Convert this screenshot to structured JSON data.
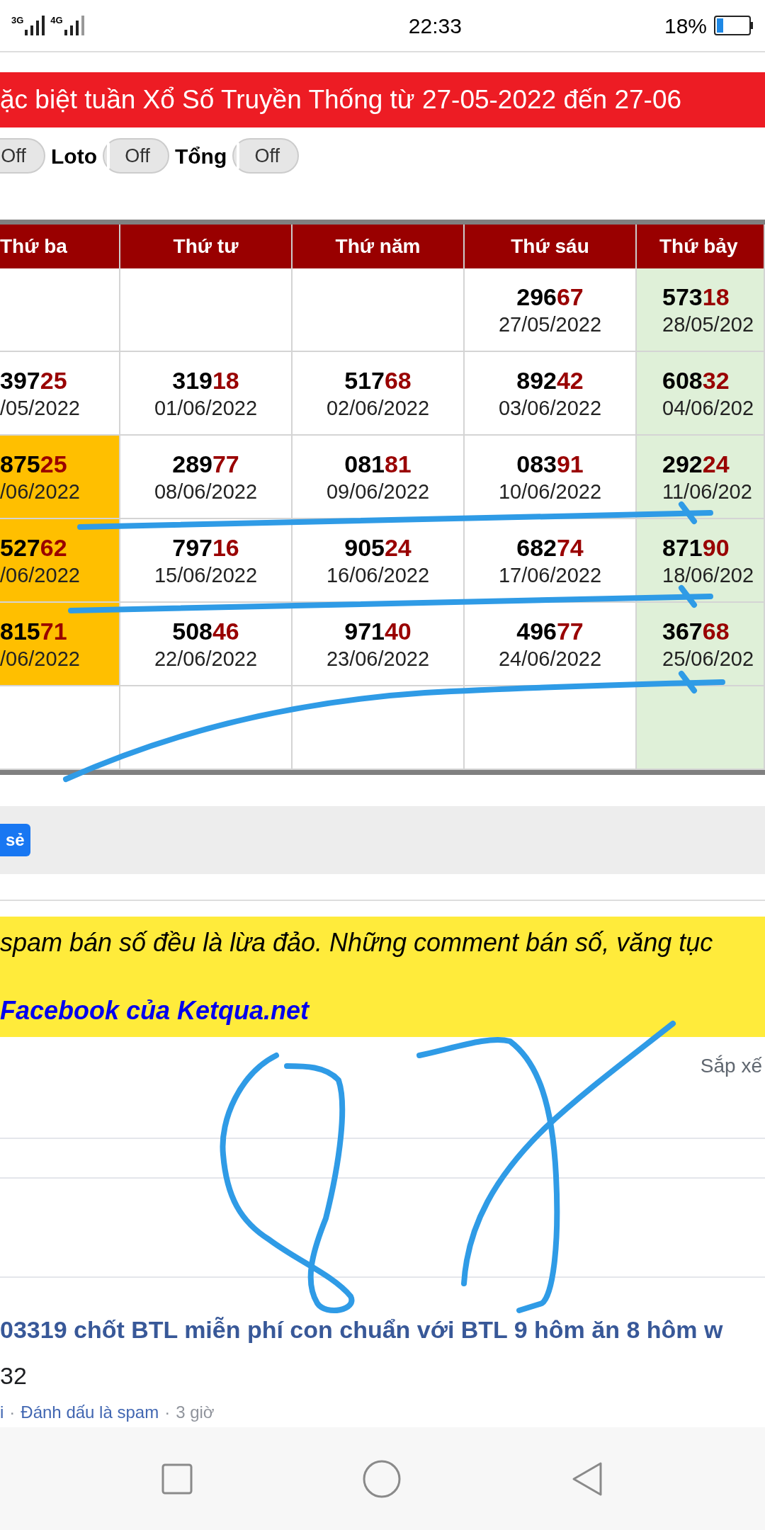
{
  "status_bar": {
    "network_1": "3G",
    "network_2": "4G",
    "time": "22:33",
    "battery": "18%"
  },
  "banner": {
    "title": "ặc biệt tuần Xổ Số Truyền Thống từ 27-05-2022 đến 27-06"
  },
  "toggles": [
    {
      "state_text": "Off",
      "on": false
    },
    {
      "label": "Loto",
      "state_text": "Off",
      "on": false
    },
    {
      "label": "Tổng",
      "state_text": "Off",
      "on": false
    }
  ],
  "table": {
    "columns": [
      "Thứ ba",
      "Thứ tư",
      "Thứ năm",
      "Thứ sáu",
      "Thứ bảy"
    ],
    "rows": [
      [
        {
          "color": "#ffffff"
        },
        {
          "color": "#ffffff"
        },
        {
          "color": "#ffffff"
        },
        {
          "prefix": "296",
          "tail": "67",
          "date": "27/05/2022",
          "color": "#ffffff"
        },
        {
          "prefix": "573",
          "tail": "18",
          "date": "28/05/202",
          "color": "#dff0d8"
        }
      ],
      [
        {
          "prefix": "397",
          "tail": "25",
          "date": "/05/2022",
          "color": "#ffffff"
        },
        {
          "prefix": "319",
          "tail": "18",
          "date": "01/06/2022",
          "color": "#ffffff"
        },
        {
          "prefix": "517",
          "tail": "68",
          "date": "02/06/2022",
          "color": "#ffffff"
        },
        {
          "prefix": "892",
          "tail": "42",
          "date": "03/06/2022",
          "color": "#ffffff"
        },
        {
          "prefix": "608",
          "tail": "32",
          "date": "04/06/202",
          "color": "#dff0d8"
        }
      ],
      [
        {
          "prefix": "875",
          "tail": "25",
          "date": "/06/2022",
          "color": "#ffbf00"
        },
        {
          "prefix": "289",
          "tail": "77",
          "date": "08/06/2022",
          "color": "#ffffff"
        },
        {
          "prefix": "081",
          "tail": "81",
          "date": "09/06/2022",
          "color": "#ffffff"
        },
        {
          "prefix": "083",
          "tail": "91",
          "date": "10/06/2022",
          "color": "#ffffff"
        },
        {
          "prefix": "292",
          "tail": "24",
          "date": "11/06/202",
          "color": "#dff0d8"
        }
      ],
      [
        {
          "prefix": "527",
          "tail": "62",
          "date": "/06/2022",
          "color": "#ffbf00"
        },
        {
          "prefix": "797",
          "tail": "16",
          "date": "15/06/2022",
          "color": "#ffffff"
        },
        {
          "prefix": "905",
          "tail": "24",
          "date": "16/06/2022",
          "color": "#ffffff"
        },
        {
          "prefix": "682",
          "tail": "74",
          "date": "17/06/2022",
          "color": "#ffffff"
        },
        {
          "prefix": "871",
          "tail": "90",
          "date": "18/06/202",
          "color": "#dff0d8"
        }
      ],
      [
        {
          "prefix": "815",
          "tail": "71",
          "date": "/06/2022",
          "color": "#ffbf00"
        },
        {
          "prefix": "508",
          "tail": "46",
          "date": "22/06/2022",
          "color": "#ffffff"
        },
        {
          "prefix": "971",
          "tail": "40",
          "date": "23/06/2022",
          "color": "#ffffff"
        },
        {
          "prefix": "496",
          "tail": "77",
          "date": "24/06/2022",
          "color": "#ffffff"
        },
        {
          "prefix": "367",
          "tail": "68",
          "date": "25/06/202",
          "color": "#dff0d8"
        }
      ],
      [
        {
          "color": "#ffffff"
        },
        {
          "color": "#ffffff"
        },
        {
          "color": "#ffffff"
        },
        {
          "color": "#ffffff"
        },
        {
          "color": "#dff0d8"
        }
      ]
    ]
  },
  "share_bar": {
    "button": "sẻ"
  },
  "notice": {
    "text": "spam bán số đều là lừa đảo. Những comment bán số, văng tục",
    "link": "Facebook của Ketqua.net"
  },
  "comments": {
    "sort_label": "Sắp xế"
  },
  "comment": {
    "separator": "·",
    "title": "03319 chốt BTL miễn phí con chuẩn với BTL 9 hôm ăn 8 hôm w",
    "body": "32",
    "actions": [
      {
        "kind": "link",
        "text": "i"
      },
      {
        "kind": "link",
        "text": "Đánh dấu là spam"
      },
      {
        "kind": "time",
        "text": "3 giờ"
      }
    ]
  }
}
